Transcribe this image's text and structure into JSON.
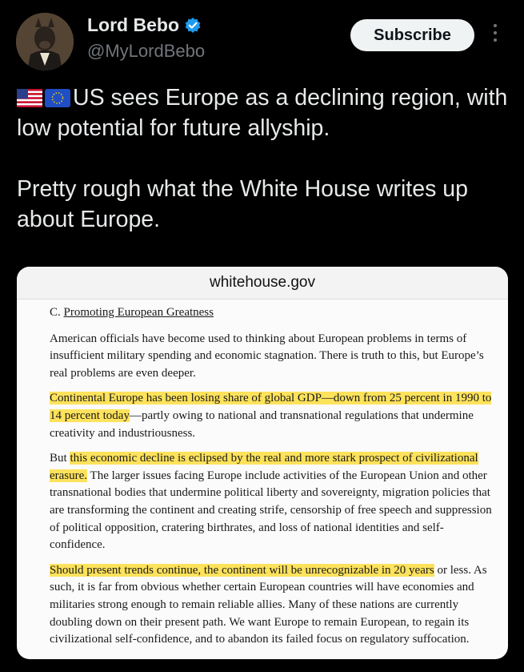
{
  "author": {
    "display_name": "Lord Bebo",
    "handle": "@MyLordBebo"
  },
  "actions": {
    "subscribe_label": "Subscribe"
  },
  "tweet": {
    "line1": "US sees Europe as a declining region, with low potential for future allyship.",
    "line2": "Pretty rough what the White House writes up about Europe."
  },
  "card": {
    "domain": "whitehouse.gov",
    "section_prefix": "C. ",
    "section_title": "Promoting European Greatness",
    "p1": "American officials have become used to thinking about European problems in terms of insufficient military spending and economic stagnation. There is truth to this, but Europe’s real problems are even deeper.",
    "p2_hl": "Continental Europe has been losing share of global GDP—down from 25 percent in 1990 to 14 percent today",
    "p2_rest": "—partly owing to national and transnational regulations that undermine creativity and industriousness.",
    "p3_lead": "But ",
    "p3_hl": "this economic decline is eclipsed by the real and more stark prospect of civilizational erasure.",
    "p3_rest": " The larger issues facing Europe include activities of the European Union and other transnational bodies that undermine political liberty and sovereignty, migration policies that are transforming the continent and creating strife, censorship of free speech and suppression of political opposition, cratering birthrates, and loss of national identities and self-confidence.",
    "p4_hl": "Should present trends continue, the continent will be unrecognizable in 20 years",
    "p4_rest": " or less. As such, it is far from obvious whether certain European countries will have economies and militaries strong enough to remain reliable allies. Many of these nations are currently doubling down on their present path. We want Europe to remain European, to regain its civilizational self-confidence, and to abandon its failed focus on regulatory suffocation."
  },
  "colors": {
    "background": "#000000",
    "highlight": "#fde25c",
    "verified": "#1d9bf0"
  },
  "icons": [
    "avatar",
    "verified-badge-icon",
    "more-options-icon",
    "us-flag-icon",
    "eu-flag-icon"
  ]
}
